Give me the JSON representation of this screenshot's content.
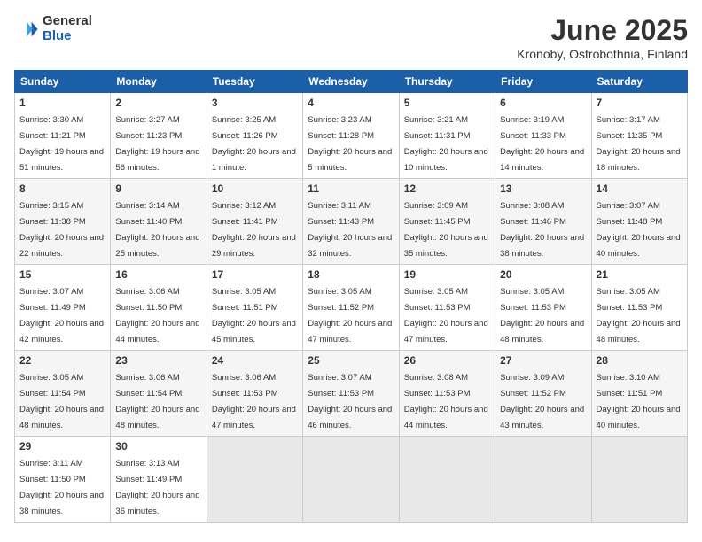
{
  "header": {
    "logo_general": "General",
    "logo_blue": "Blue",
    "month_title": "June 2025",
    "location": "Kronoby, Ostrobothnia, Finland"
  },
  "weekdays": [
    "Sunday",
    "Monday",
    "Tuesday",
    "Wednesday",
    "Thursday",
    "Friday",
    "Saturday"
  ],
  "weeks": [
    [
      {
        "day": "1",
        "sunrise": "3:30 AM",
        "sunset": "11:21 PM",
        "daylight": "19 hours and 51 minutes."
      },
      {
        "day": "2",
        "sunrise": "3:27 AM",
        "sunset": "11:23 PM",
        "daylight": "19 hours and 56 minutes."
      },
      {
        "day": "3",
        "sunrise": "3:25 AM",
        "sunset": "11:26 PM",
        "daylight": "20 hours and 1 minute."
      },
      {
        "day": "4",
        "sunrise": "3:23 AM",
        "sunset": "11:28 PM",
        "daylight": "20 hours and 5 minutes."
      },
      {
        "day": "5",
        "sunrise": "3:21 AM",
        "sunset": "11:31 PM",
        "daylight": "20 hours and 10 minutes."
      },
      {
        "day": "6",
        "sunrise": "3:19 AM",
        "sunset": "11:33 PM",
        "daylight": "20 hours and 14 minutes."
      },
      {
        "day": "7",
        "sunrise": "3:17 AM",
        "sunset": "11:35 PM",
        "daylight": "20 hours and 18 minutes."
      }
    ],
    [
      {
        "day": "8",
        "sunrise": "3:15 AM",
        "sunset": "11:38 PM",
        "daylight": "20 hours and 22 minutes."
      },
      {
        "day": "9",
        "sunrise": "3:14 AM",
        "sunset": "11:40 PM",
        "daylight": "20 hours and 25 minutes."
      },
      {
        "day": "10",
        "sunrise": "3:12 AM",
        "sunset": "11:41 PM",
        "daylight": "20 hours and 29 minutes."
      },
      {
        "day": "11",
        "sunrise": "3:11 AM",
        "sunset": "11:43 PM",
        "daylight": "20 hours and 32 minutes."
      },
      {
        "day": "12",
        "sunrise": "3:09 AM",
        "sunset": "11:45 PM",
        "daylight": "20 hours and 35 minutes."
      },
      {
        "day": "13",
        "sunrise": "3:08 AM",
        "sunset": "11:46 PM",
        "daylight": "20 hours and 38 minutes."
      },
      {
        "day": "14",
        "sunrise": "3:07 AM",
        "sunset": "11:48 PM",
        "daylight": "20 hours and 40 minutes."
      }
    ],
    [
      {
        "day": "15",
        "sunrise": "3:07 AM",
        "sunset": "11:49 PM",
        "daylight": "20 hours and 42 minutes."
      },
      {
        "day": "16",
        "sunrise": "3:06 AM",
        "sunset": "11:50 PM",
        "daylight": "20 hours and 44 minutes."
      },
      {
        "day": "17",
        "sunrise": "3:05 AM",
        "sunset": "11:51 PM",
        "daylight": "20 hours and 45 minutes."
      },
      {
        "day": "18",
        "sunrise": "3:05 AM",
        "sunset": "11:52 PM",
        "daylight": "20 hours and 47 minutes."
      },
      {
        "day": "19",
        "sunrise": "3:05 AM",
        "sunset": "11:53 PM",
        "daylight": "20 hours and 47 minutes."
      },
      {
        "day": "20",
        "sunrise": "3:05 AM",
        "sunset": "11:53 PM",
        "daylight": "20 hours and 48 minutes."
      },
      {
        "day": "21",
        "sunrise": "3:05 AM",
        "sunset": "11:53 PM",
        "daylight": "20 hours and 48 minutes."
      }
    ],
    [
      {
        "day": "22",
        "sunrise": "3:05 AM",
        "sunset": "11:54 PM",
        "daylight": "20 hours and 48 minutes."
      },
      {
        "day": "23",
        "sunrise": "3:06 AM",
        "sunset": "11:54 PM",
        "daylight": "20 hours and 48 minutes."
      },
      {
        "day": "24",
        "sunrise": "3:06 AM",
        "sunset": "11:53 PM",
        "daylight": "20 hours and 47 minutes."
      },
      {
        "day": "25",
        "sunrise": "3:07 AM",
        "sunset": "11:53 PM",
        "daylight": "20 hours and 46 minutes."
      },
      {
        "day": "26",
        "sunrise": "3:08 AM",
        "sunset": "11:53 PM",
        "daylight": "20 hours and 44 minutes."
      },
      {
        "day": "27",
        "sunrise": "3:09 AM",
        "sunset": "11:52 PM",
        "daylight": "20 hours and 43 minutes."
      },
      {
        "day": "28",
        "sunrise": "3:10 AM",
        "sunset": "11:51 PM",
        "daylight": "20 hours and 40 minutes."
      }
    ],
    [
      {
        "day": "29",
        "sunrise": "3:11 AM",
        "sunset": "11:50 PM",
        "daylight": "20 hours and 38 minutes."
      },
      {
        "day": "30",
        "sunrise": "3:13 AM",
        "sunset": "11:49 PM",
        "daylight": "20 hours and 36 minutes."
      },
      null,
      null,
      null,
      null,
      null
    ]
  ]
}
